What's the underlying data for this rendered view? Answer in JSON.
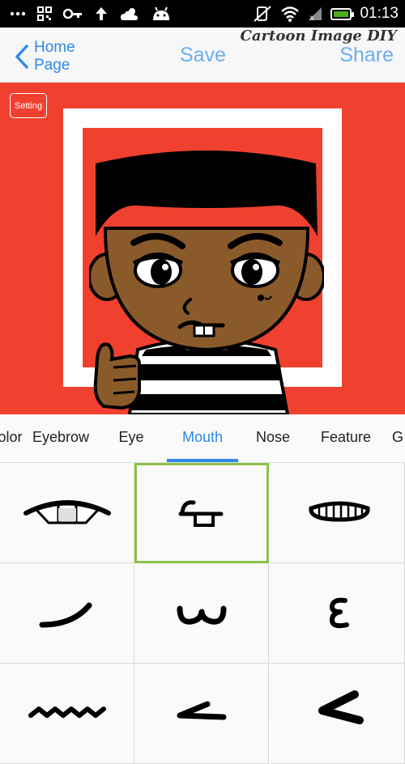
{
  "status_bar": {
    "time": "01:13"
  },
  "header": {
    "back_label": "Home Page",
    "save_label": "Save",
    "share_label": "Share",
    "watermark": "Cartoon Image DIY"
  },
  "canvas": {
    "setting_label": "Setting",
    "background_color": "#f0402f"
  },
  "tabs": [
    {
      "label": "Color"
    },
    {
      "label": "Eyebrow"
    },
    {
      "label": "Eye"
    },
    {
      "label": "Mouth",
      "active": true
    },
    {
      "label": "Nose"
    },
    {
      "label": "Feature"
    },
    {
      "label": "G"
    }
  ],
  "mouth_options": [
    {
      "icon": "mouth-teeth-grin-icon"
    },
    {
      "icon": "mouth-smirk-tooth-icon",
      "selected": true
    },
    {
      "icon": "mouth-teeth-row-icon"
    },
    {
      "icon": "mouth-curve-smile-icon"
    },
    {
      "icon": "mouth-w-shape-icon"
    },
    {
      "icon": "mouth-3-shape-icon"
    },
    {
      "icon": "mouth-zigzag-icon"
    },
    {
      "icon": "mouth-arrow-left-icon"
    },
    {
      "icon": "mouth-arrow-left-bold-icon"
    }
  ],
  "colors": {
    "accent": "#2d8ae8",
    "selection": "#8bc34a",
    "canvas": "#f0402f"
  }
}
